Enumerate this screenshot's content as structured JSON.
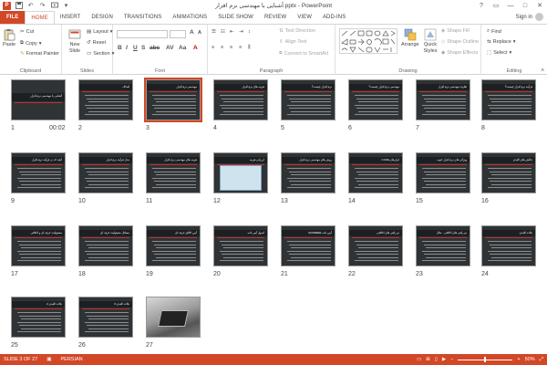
{
  "app": {
    "title": "آشنایی با مهندسی نرم افزار.pptx - PowerPoint",
    "icon_letter": "P",
    "qat": [
      "save-icon",
      "undo-icon",
      "redo-icon",
      "slideshow-icon",
      "customize-icon"
    ],
    "window_controls": [
      "?",
      "▭",
      "—",
      "□",
      "✕"
    ]
  },
  "tabs": [
    {
      "label": "FILE"
    },
    {
      "label": "HOME"
    },
    {
      "label": "INSERT"
    },
    {
      "label": "DESIGN"
    },
    {
      "label": "TRANSITIONS"
    },
    {
      "label": "ANIMATIONS"
    },
    {
      "label": "SLIDE SHOW"
    },
    {
      "label": "REVIEW"
    },
    {
      "label": "VIEW"
    },
    {
      "label": "ADD-INS"
    }
  ],
  "signin": "Sign in",
  "ribbon": {
    "clipboard": {
      "label": "Clipboard",
      "paste": "Paste",
      "cut": "Cut",
      "copy": "Copy",
      "format_painter": "Format Painter"
    },
    "slides": {
      "label": "Slides",
      "new_slide": "New Slide",
      "layout": "Layout",
      "reset": "Reset",
      "section": "Section"
    },
    "font": {
      "label": "Font"
    },
    "paragraph": {
      "label": "Paragraph",
      "text_direction": "Text Direction",
      "align_text": "Align Text",
      "convert_smartart": "Convert to SmartArt"
    },
    "drawing": {
      "label": "Drawing",
      "arrange": "Arrange",
      "quick_styles": "Quick Styles",
      "shape_fill": "Shape Fill",
      "shape_outline": "Shape Outline",
      "shape_effects": "Shape Effects"
    },
    "editing": {
      "label": "Editing",
      "find": "Find",
      "replace": "Replace",
      "select": "Select"
    }
  },
  "slides": [
    {
      "num": "1",
      "time": "00:02",
      "title": "آشنایی با مهندسی نرم افزار",
      "kind": "title"
    },
    {
      "num": "2",
      "title": "اهداف",
      "kind": "text"
    },
    {
      "num": "3",
      "title": "مهندسی نرم افزار",
      "kind": "text",
      "selected": true
    },
    {
      "num": "4",
      "title": "هزینه های نرم افزار",
      "kind": "text"
    },
    {
      "num": "5",
      "title": "نرم افزار چیست؟",
      "kind": "text"
    },
    {
      "num": "6",
      "title": "مهندسی نرم افزار چیست؟",
      "kind": "text"
    },
    {
      "num": "7",
      "title": "تفاوت مهندسی نرم افزار",
      "kind": "text"
    },
    {
      "num": "8",
      "title": "فرآیند نرم افزار چیست؟",
      "kind": "text"
    },
    {
      "num": "9",
      "title": "آنچه که در فرآیند نرم افزار",
      "kind": "text"
    },
    {
      "num": "10",
      "title": "مدل فرآیند نرم افزار",
      "kind": "text"
    },
    {
      "num": "11",
      "title": "هزینه های مهندسی نرم افزار",
      "kind": "text"
    },
    {
      "num": "12",
      "title": "ارزیابی هزینه",
      "kind": "screenshot"
    },
    {
      "num": "13",
      "title": "روش های مهندسی نرم افزار",
      "kind": "text"
    },
    {
      "num": "14",
      "title": "ابزارهای CASE",
      "kind": "text"
    },
    {
      "num": "15",
      "title": "ویژگی های نرم افزار خوب",
      "kind": "text"
    },
    {
      "num": "16",
      "title": "چالش های کلیدی",
      "kind": "text"
    },
    {
      "num": "17",
      "title": "مسئولیت حرفه ای و اخلاقی",
      "kind": "text"
    },
    {
      "num": "18",
      "title": "مسائل مسئولیت حرفه ای",
      "kind": "text"
    },
    {
      "num": "19",
      "title": "آیین اخلاق حرفه ای",
      "kind": "text"
    },
    {
      "num": "20",
      "title": "اصول آیین نامه",
      "kind": "text"
    },
    {
      "num": "21",
      "title": "آیین نامه ACM/IEEE",
      "kind": "text"
    },
    {
      "num": "22",
      "title": "دو راهی های اخلاقی",
      "kind": "text"
    },
    {
      "num": "23",
      "title": "دو راهی های اخلاقی - مثال",
      "kind": "text"
    },
    {
      "num": "24",
      "title": "نکات کلیدی",
      "kind": "text"
    },
    {
      "num": "25",
      "title": "نکات کلیدی 2",
      "kind": "text"
    },
    {
      "num": "26",
      "title": "نکات کلیدی 3",
      "kind": "text"
    },
    {
      "num": "27",
      "title": "",
      "kind": "photo"
    }
  ],
  "status": {
    "slide_of": "SLIDE 3 OF 27",
    "language": "PERSIAN",
    "zoom": "50%",
    "zoom_fraction": 0.5
  },
  "colors": {
    "accent": "#d24726",
    "slide_bg": "#2f3335",
    "selected": "#d24726"
  }
}
